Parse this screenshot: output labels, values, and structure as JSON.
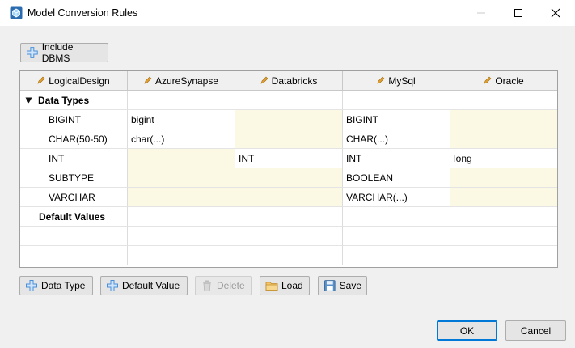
{
  "window": {
    "title": "Model Conversion Rules",
    "icon": "cube-app-icon",
    "controls": [
      "minimize-icon",
      "maximize-icon",
      "close-icon"
    ]
  },
  "toolbar": {
    "include_dbms": "Include DBMS"
  },
  "grid": {
    "columns": [
      "LogicalDesign",
      "AzureSynapse",
      "Databricks",
      "MySql",
      "Oracle"
    ],
    "groups": {
      "data_types": "Data Types",
      "default_values": "Default Values"
    },
    "rows": [
      {
        "name": "BIGINT",
        "values": [
          "bigint",
          "",
          "BIGINT",
          ""
        ]
      },
      {
        "name": "CHAR(50-50)",
        "values": [
          "char(...)",
          "",
          "CHAR(...)",
          ""
        ]
      },
      {
        "name": "INT",
        "values": [
          "",
          "INT",
          "INT",
          "long"
        ]
      },
      {
        "name": "SUBTYPE",
        "values": [
          "",
          "",
          "BOOLEAN",
          ""
        ]
      },
      {
        "name": "VARCHAR",
        "values": [
          "",
          "",
          "VARCHAR(...)",
          ""
        ]
      }
    ],
    "highlight_color": "#fbf8e4"
  },
  "actions": {
    "data_type": "Data Type",
    "default_value": "Default Value",
    "delete": "Delete",
    "load": "Load",
    "save": "Save"
  },
  "footer": {
    "ok": "OK",
    "cancel": "Cancel"
  },
  "colors": {
    "accent": "#0078d7",
    "add_icon": "#4a90d9",
    "folder_icon": "#e8b34a"
  }
}
